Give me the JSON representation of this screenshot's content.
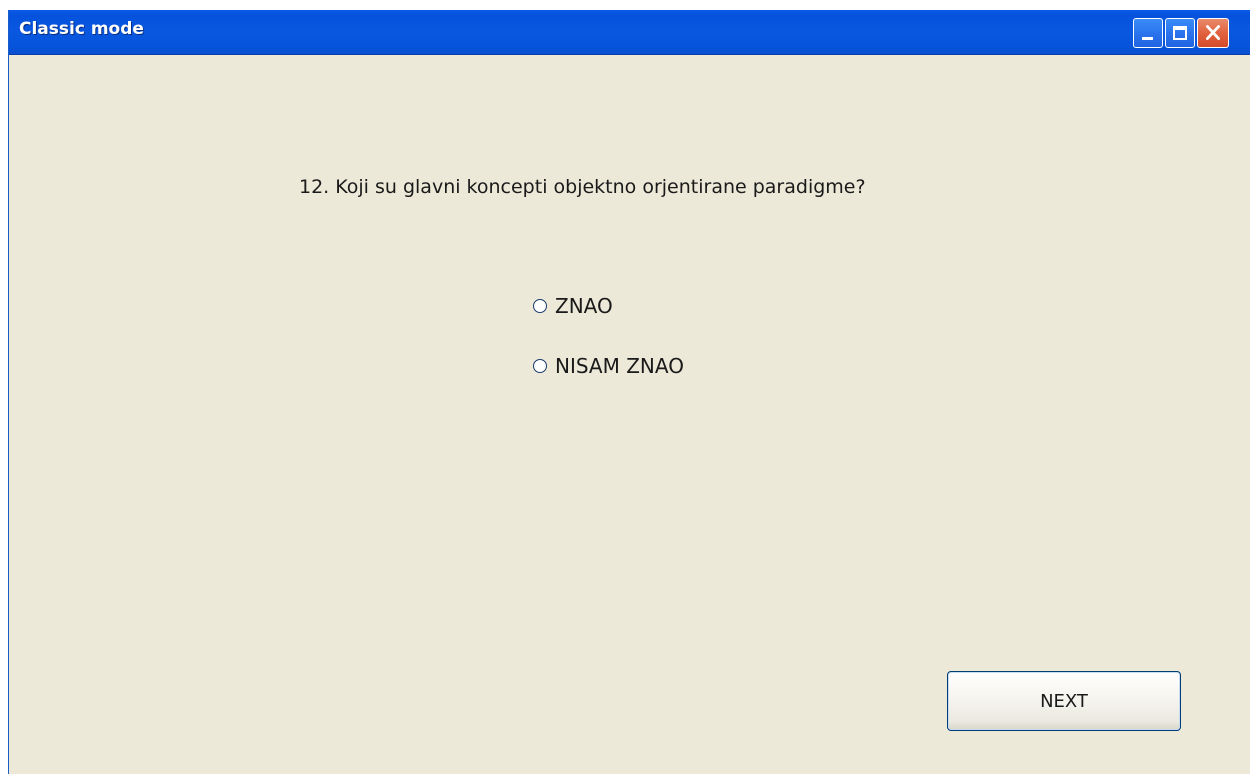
{
  "window": {
    "title": "Classic mode"
  },
  "question": {
    "text": "12. Koji su glavni koncepti objektno orjentirane paradigme?"
  },
  "options": [
    {
      "label": "ZNAO",
      "selected": false
    },
    {
      "label": "NISAM ZNAO",
      "selected": false
    }
  ],
  "buttons": {
    "next_label": "NEXT"
  },
  "icons": {
    "minimize": "minimize-icon",
    "maximize": "maximize-icon",
    "close": "close-icon"
  },
  "colors": {
    "titlebar": "#0a57e0",
    "background": "#ece9d8",
    "close_button": "#e2623f"
  }
}
